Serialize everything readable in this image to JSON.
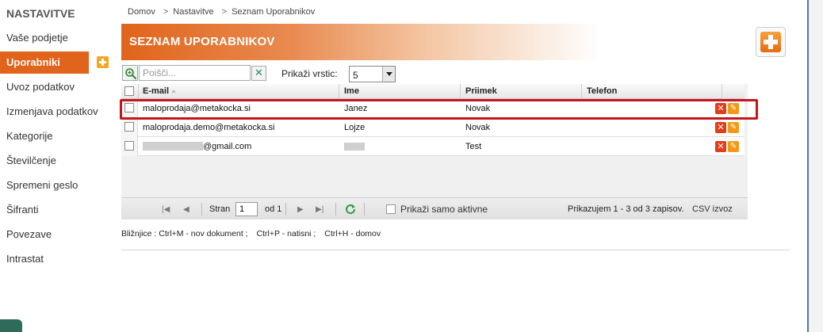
{
  "sidebar": {
    "title": "NASTAVITVE",
    "items": [
      {
        "label": "Vaše podjetje"
      },
      {
        "label": "Uporabniki"
      },
      {
        "label": "Uvoz podatkov"
      },
      {
        "label": "Izmenjava podatkov"
      },
      {
        "label": "Kategorije"
      },
      {
        "label": "Številčenje"
      },
      {
        "label": "Spremeni geslo"
      },
      {
        "label": "Šifranti"
      },
      {
        "label": "Povezave"
      },
      {
        "label": "Intrastat"
      }
    ],
    "active_item": "Uporabniki"
  },
  "breadcrumb": {
    "items": [
      "Domov",
      "Nastavitve",
      "Seznam Uporabnikov"
    ],
    "separator": ">"
  },
  "header": {
    "title": "SEZNAM UPORABNIKOV"
  },
  "toolbar": {
    "search_placeholder": "Poišči...",
    "rows_label": "Prikaži vrstic:",
    "rows_value": "5"
  },
  "table": {
    "columns": [
      "E-mail",
      "Ime",
      "Priimek",
      "Telefon"
    ],
    "rows": [
      {
        "email": "maloprodaja@metakocka.si",
        "ime": "Janez",
        "priimek": "Novak",
        "telefon": ""
      },
      {
        "email": "maloprodaja.demo@metakocka.si",
        "ime": "Lojze",
        "priimek": "Novak",
        "telefon": ""
      },
      {
        "email": "@gmail.com",
        "ime": "",
        "priimek": "Test",
        "telefon": ""
      }
    ]
  },
  "pager": {
    "page_label": "Stran",
    "page_value": "1",
    "of_label": "od 1",
    "only_active_label": "Prikaži samo aktivne",
    "count_text": "Prikazujem 1 - 3 od 3 zapisov.",
    "csv_label": "CSV izvoz"
  },
  "shortcuts": [
    "Bližnjice : Ctrl+M - nov dokument ;",
    "Ctrl+P - natisni ;",
    "Ctrl+H - domov"
  ],
  "colors": {
    "accent": "#e0641b",
    "highlight": "#c3161c",
    "delete": "#e23c1a",
    "edit": "#f29a18"
  }
}
